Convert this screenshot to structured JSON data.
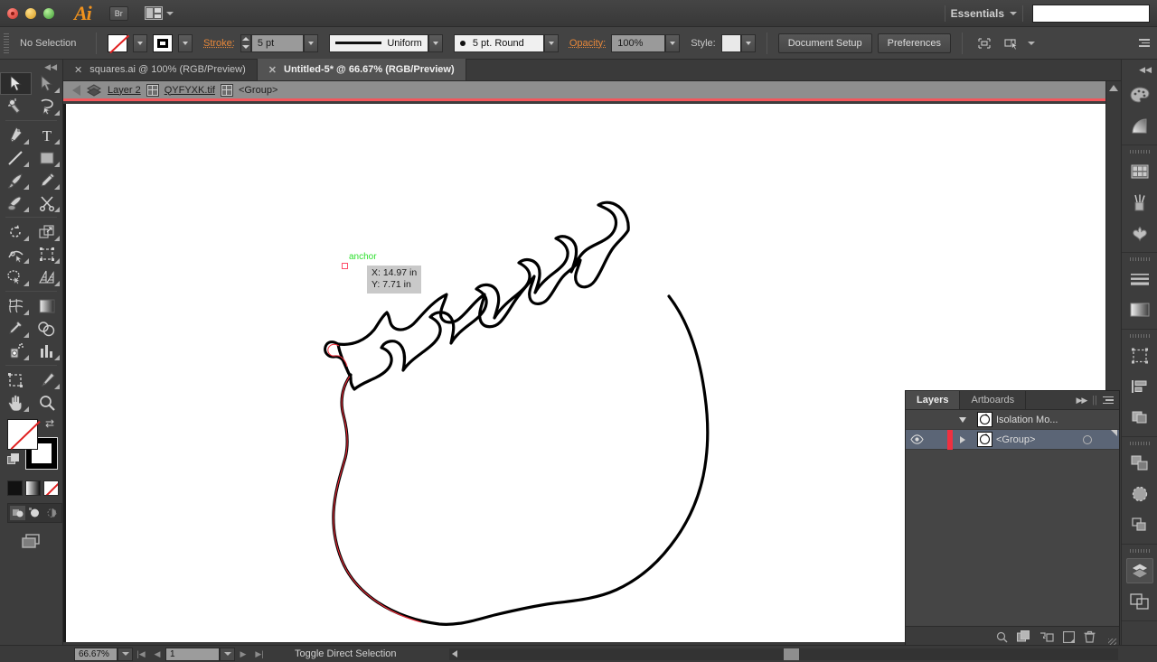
{
  "app": {
    "name": "Adobe Illustrator",
    "logo_text": "Ai",
    "bridge_button": "Br",
    "workspace": "Essentials"
  },
  "control_bar": {
    "selection_status": "No Selection",
    "fill_swatch": "none-swatch",
    "stroke_swatch": "black-stroke-swatch",
    "stroke_label": "Stroke:",
    "stroke_weight": "5 pt",
    "stroke_profile": "Uniform",
    "brush_definition": "5 pt. Round",
    "opacity_label": "Opacity:",
    "opacity_value": "100%",
    "style_label": "Style:",
    "document_setup_button": "Document Setup",
    "preferences_button": "Preferences"
  },
  "tabs": [
    {
      "title": "squares.ai @ 100% (RGB/Preview)",
      "active": false
    },
    {
      "title": "Untitled-5* @ 66.67% (RGB/Preview)",
      "active": true
    }
  ],
  "breadcrumb": {
    "layer": "Layer 2",
    "image": "QYFYXK.tif",
    "group": "<Group>"
  },
  "canvas": {
    "anchor_label": "anchor",
    "tooltip_x": "X: 14.97 in",
    "tooltip_y": "Y: 7.71 in"
  },
  "layers_panel": {
    "tabs": [
      {
        "label": "Layers",
        "active": true
      },
      {
        "label": "Artboards",
        "active": false
      }
    ],
    "rows": [
      {
        "name": "Isolation Mo...",
        "selected": false,
        "expanded": true,
        "has_eye": false
      },
      {
        "name": "<Group>",
        "selected": true,
        "expanded": false,
        "has_eye": true
      }
    ],
    "footer_icons": [
      "locate-object-icon",
      "make-sublayer-icon",
      "make-clipping-mask-icon",
      "new-layer-icon",
      "delete-selection-icon"
    ]
  },
  "tools": [
    {
      "name": "selection-tool",
      "active": true
    },
    {
      "name": "direct-selection-tool",
      "active": false
    },
    {
      "name": "magic-wand-tool",
      "active": false
    },
    {
      "name": "lasso-tool",
      "active": false
    },
    {
      "name": "pen-tool",
      "active": false
    },
    {
      "name": "type-tool",
      "active": false
    },
    {
      "name": "line-segment-tool",
      "active": false
    },
    {
      "name": "rectangle-tool",
      "active": false
    },
    {
      "name": "paintbrush-tool",
      "active": false
    },
    {
      "name": "pencil-tool",
      "active": false
    },
    {
      "name": "blob-brush-tool",
      "active": false
    },
    {
      "name": "eraser-scissors-tool",
      "active": false
    },
    {
      "name": "rotate-tool",
      "active": false
    },
    {
      "name": "scale-tool",
      "active": false
    },
    {
      "name": "width-warp-tool",
      "active": false
    },
    {
      "name": "free-transform-tool",
      "active": false
    },
    {
      "name": "shape-builder-tool",
      "active": false
    },
    {
      "name": "perspective-grid-tool",
      "active": false
    },
    {
      "name": "mesh-tool",
      "active": false
    },
    {
      "name": "gradient-tool",
      "active": false
    },
    {
      "name": "eyedropper-tool",
      "active": false
    },
    {
      "name": "blend-tool",
      "active": false
    },
    {
      "name": "symbol-sprayer-tool",
      "active": false
    },
    {
      "name": "column-graph-tool",
      "active": false
    },
    {
      "name": "artboard-tool",
      "active": false
    },
    {
      "name": "slice-tool",
      "active": false
    },
    {
      "name": "hand-tool",
      "active": false
    },
    {
      "name": "zoom-tool",
      "active": false
    }
  ],
  "right_dock": [
    {
      "name": "color-panel-icon",
      "active": false
    },
    {
      "name": "color-guide-panel-icon",
      "active": false
    },
    {
      "name": "swatches-panel-icon",
      "active": false
    },
    {
      "name": "brushes-panel-icon",
      "active": false
    },
    {
      "name": "symbols-panel-icon",
      "active": false
    },
    {
      "name": "stroke-panel-icon",
      "active": false
    },
    {
      "name": "gradient-panel-icon",
      "active": false
    },
    {
      "name": "artboards-panel-icon",
      "active": false
    },
    {
      "name": "align-panel-icon",
      "active": false
    },
    {
      "name": "pathfinder-panel-icon",
      "active": false
    },
    {
      "name": "transform-panel-icon",
      "active": false
    },
    {
      "name": "transparency-panel-icon",
      "active": false
    },
    {
      "name": "layers-panel-icon",
      "active": true
    },
    {
      "name": "links-panel-icon",
      "active": false
    }
  ],
  "status_bar": {
    "zoom_level": "66.67%",
    "page_number": "1",
    "status_text": "Toggle Direct Selection"
  },
  "colors": {
    "chrome_bg": "#3d3d3d",
    "control_bg": "#434343",
    "accent_orange": "#e8883a",
    "isolation_red": "#f2575c",
    "anchor_green": "#2ee02e",
    "selection_blue": "#5b6576",
    "canvas_white": "#ffffff",
    "path_black": "#000000",
    "path_red": "#ee2b38"
  }
}
